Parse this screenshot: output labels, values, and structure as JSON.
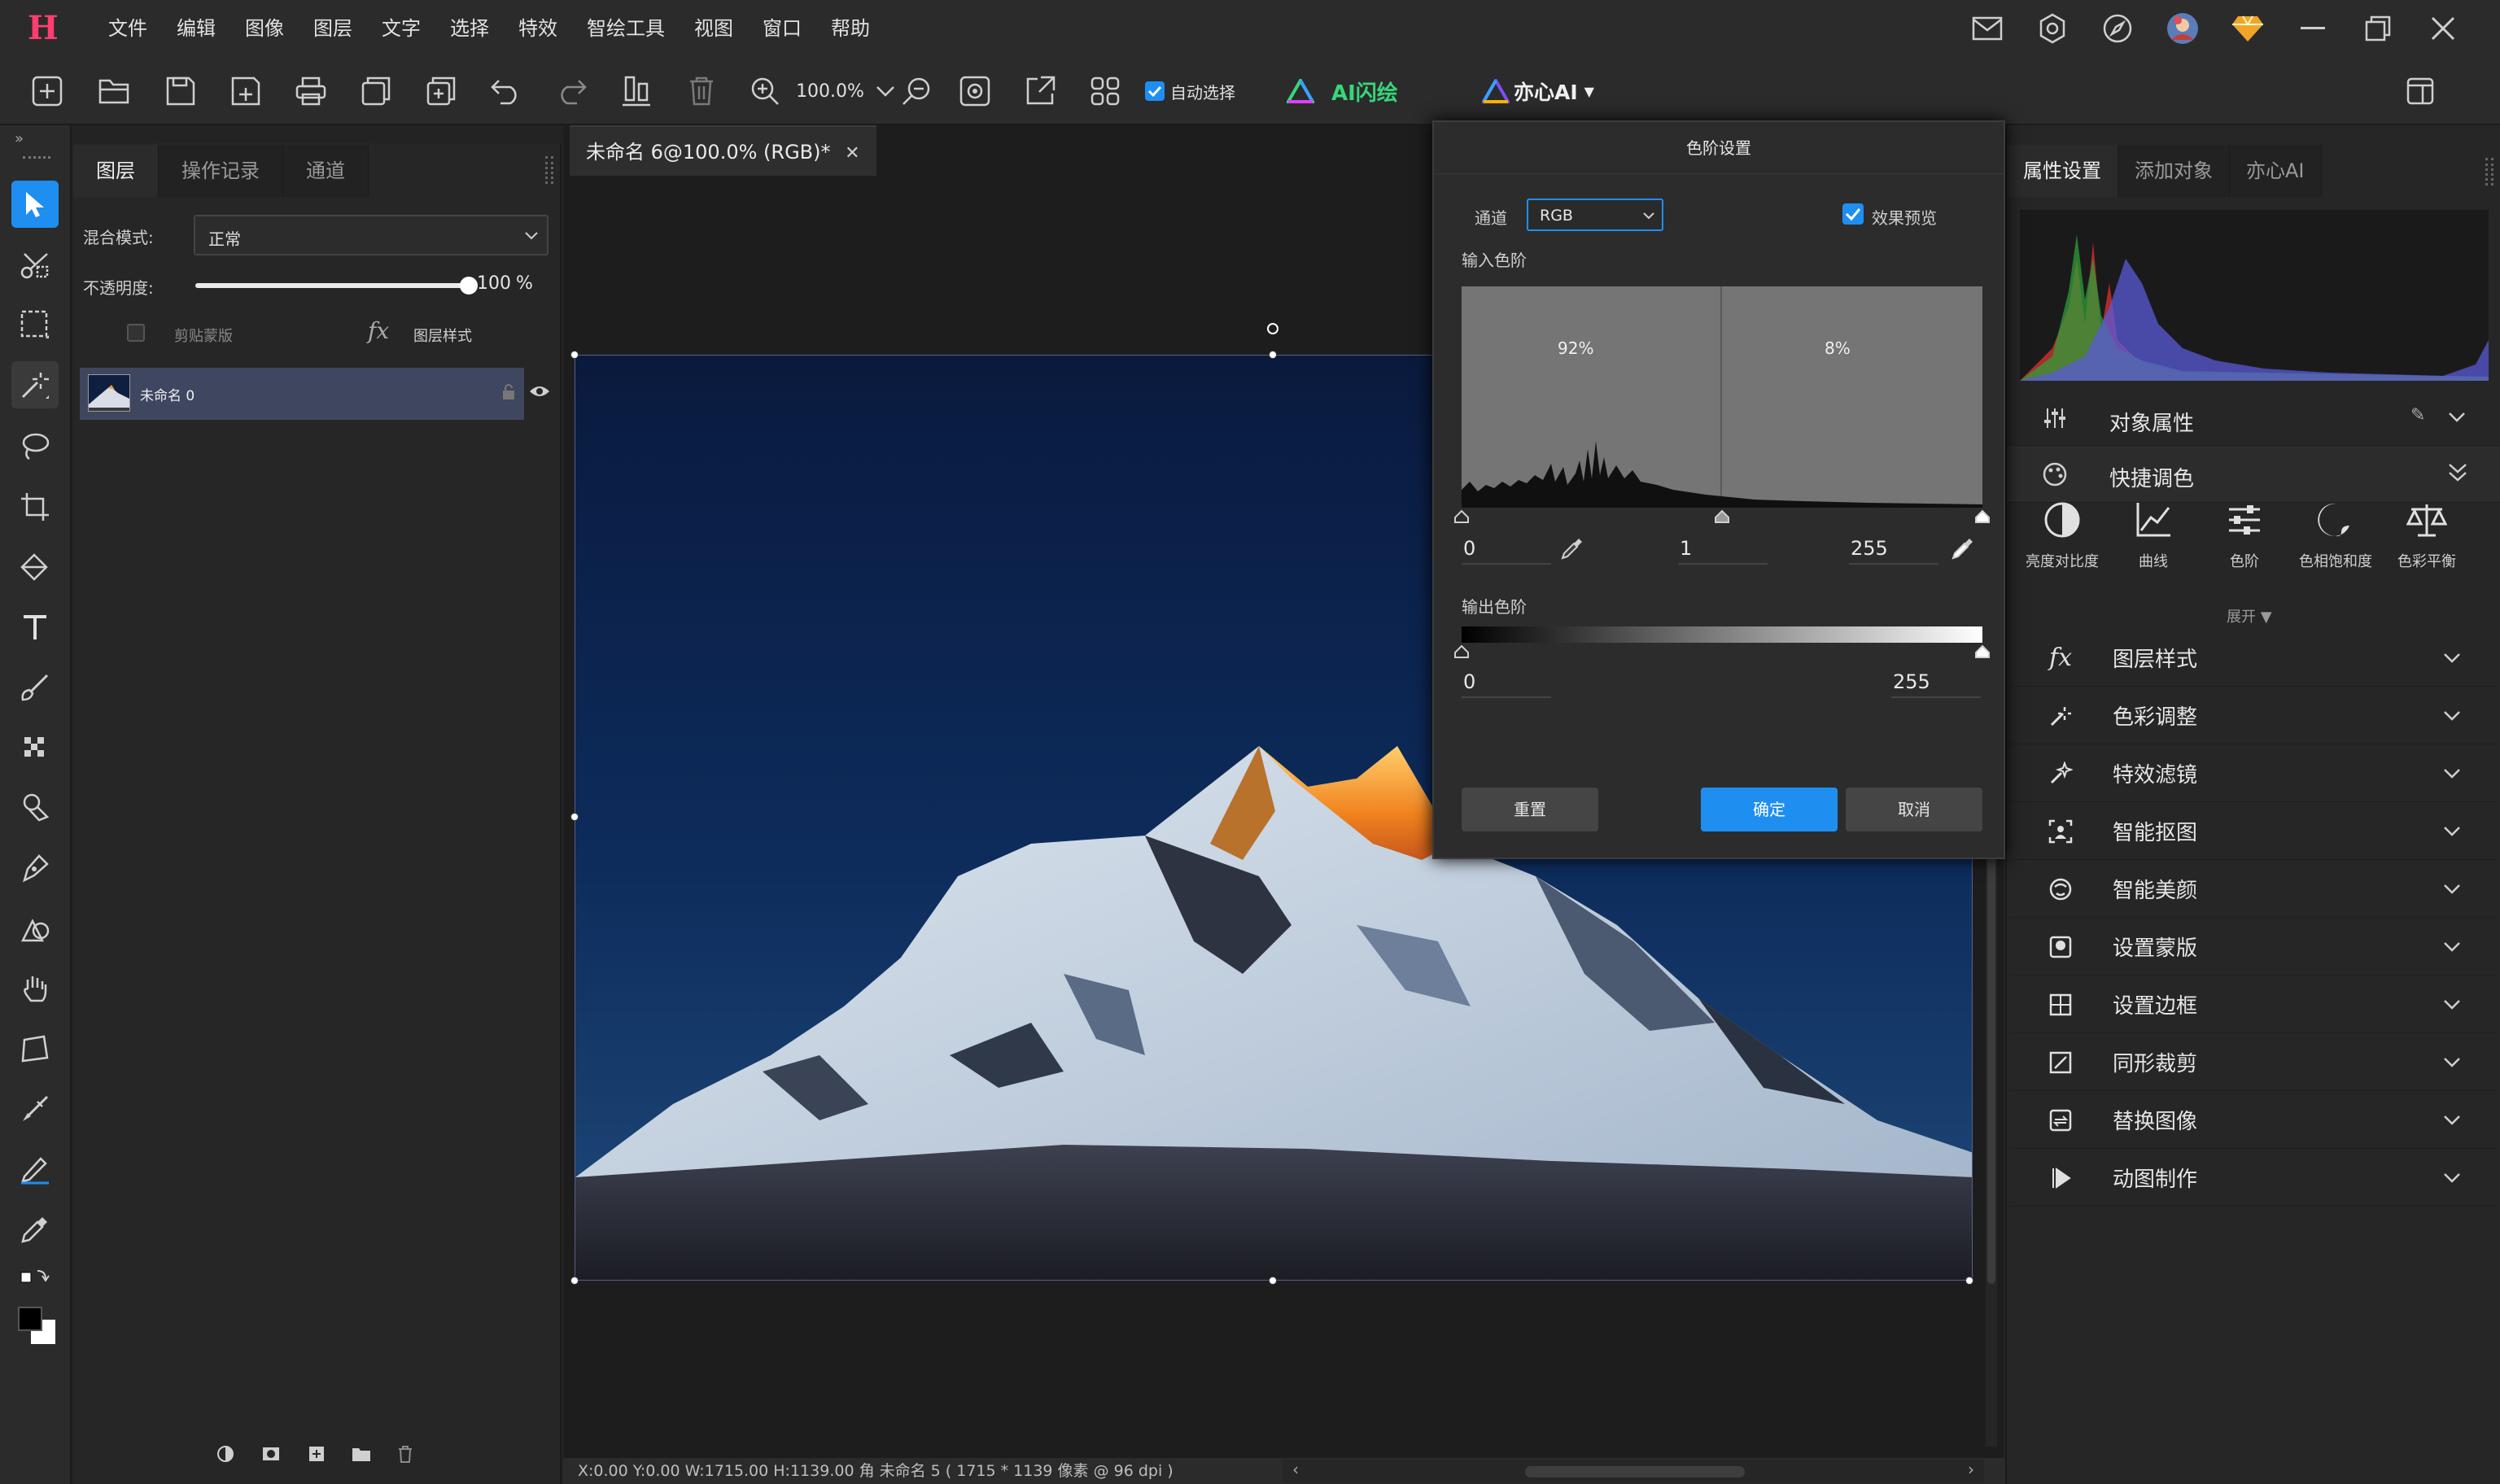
{
  "menubar": {
    "logo": "H",
    "items": [
      "文件",
      "编辑",
      "图像",
      "图层",
      "文字",
      "选择",
      "特效",
      "智绘工具",
      "视图",
      "窗口",
      "帮助"
    ],
    "icons": [
      "mail-icon",
      "settings-icon",
      "compass-icon",
      "avatar",
      "vip-gem-icon",
      "minimize-icon",
      "restore-icon",
      "close-icon"
    ]
  },
  "toolbar": {
    "zoom_value": "100.0%",
    "auto_select_label": "自动选择",
    "auto_select_checked": true,
    "ai_flash_label": "AI闪绘",
    "yixin_ai_label": "亦心AI"
  },
  "layers_panel": {
    "tabs": [
      "图层",
      "操作记录",
      "通道"
    ],
    "blend_mode_label": "混合模式:",
    "blend_mode_value": "正常",
    "opacity_label": "不透明度:",
    "opacity_value": "100",
    "opacity_unit": "%",
    "opacity_fraction": 1.0,
    "clip_mask_label": "剪贴蒙版",
    "layer_style_label": "图层样式",
    "layers": [
      {
        "name": "未命名 0",
        "visible": true
      }
    ]
  },
  "document": {
    "tab_title": "未命名 6@100.0% (RGB)*",
    "status_text": "X:0.00 Y:0.00 W:1715.00 H:1139.00 角  未命名 5 ( 1715 * 1139 像素 @ 96 dpi )"
  },
  "levels_dialog": {
    "title": "色阶设置",
    "channel_label": "通道",
    "channel_value": "RGB",
    "preview_label": "效果预览",
    "preview_checked": true,
    "input_label": "输入色阶",
    "left_pct": "92%",
    "right_pct": "8%",
    "input_black": "0",
    "input_gamma": "1",
    "input_white": "255",
    "output_label": "输出色阶",
    "output_black": "0",
    "output_white": "255",
    "reset_label": "重置",
    "ok_label": "确定",
    "cancel_label": "取消"
  },
  "right_panel": {
    "tabs": [
      "属性设置",
      "添加对象",
      "亦心AI"
    ],
    "object_props_label": "对象属性",
    "quick_adjust_label": "快捷调色",
    "quick_tools": [
      {
        "icon": "brightness-contrast-icon",
        "label": "亮度对比度"
      },
      {
        "icon": "curves-icon",
        "label": "曲线"
      },
      {
        "icon": "levels-icon",
        "label": "色阶"
      },
      {
        "icon": "hue-saturation-icon",
        "label": "色相饱和度"
      },
      {
        "icon": "color-balance-icon",
        "label": "色彩平衡"
      }
    ],
    "expand_label": "展开 ▼",
    "sections": [
      {
        "icon": "fx-icon",
        "label": "图层样式"
      },
      {
        "icon": "color-adjust-icon",
        "label": "色彩调整"
      },
      {
        "icon": "effects-filter-icon",
        "label": "特效滤镜"
      },
      {
        "icon": "smart-cutout-icon",
        "label": "智能抠图"
      },
      {
        "icon": "smart-beauty-icon",
        "label": "智能美颜"
      },
      {
        "icon": "mask-icon",
        "label": "设置蒙版"
      },
      {
        "icon": "border-icon",
        "label": "设置边框"
      },
      {
        "icon": "shape-crop-icon",
        "label": "同形裁剪"
      },
      {
        "icon": "replace-image-icon",
        "label": "替换图像"
      },
      {
        "icon": "gif-make-icon",
        "label": "动图制作"
      }
    ]
  },
  "colors": {
    "accent": "#1f8ef1",
    "logo": "#ff3d6e",
    "ai_green": "#37d67a"
  }
}
